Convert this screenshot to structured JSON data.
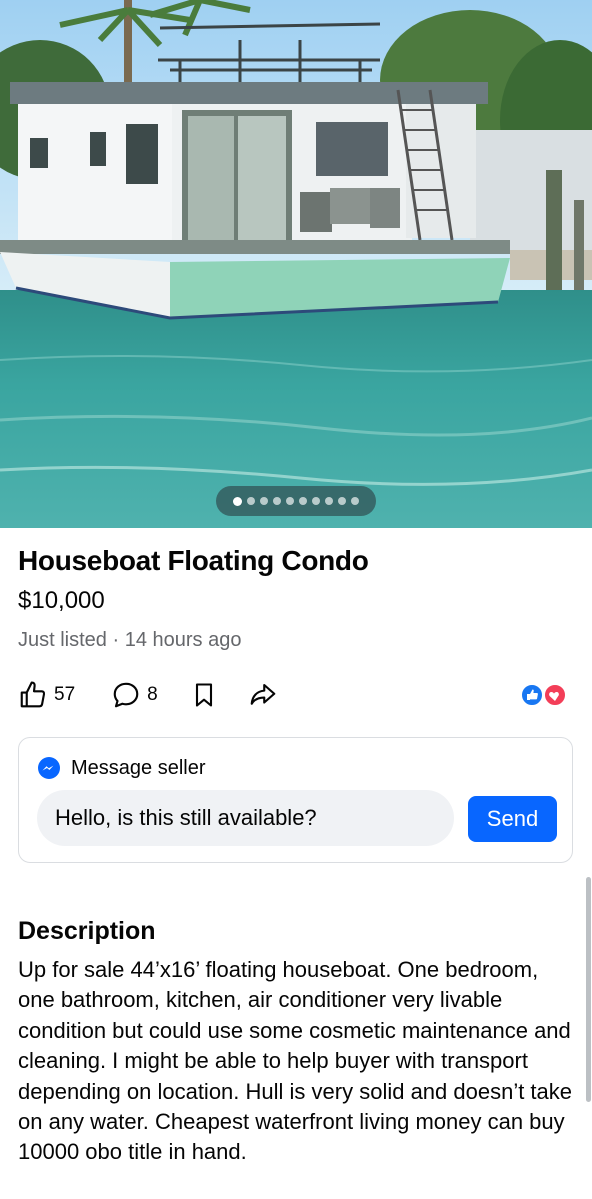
{
  "listing": {
    "title": "Houseboat Floating Condo",
    "price": "$10,000",
    "meta": "Just listed · 14 hours ago"
  },
  "photo_carousel": {
    "total_photos": 10,
    "current_index": 1,
    "subject": "white houseboat with teal hull on water"
  },
  "actions": {
    "like_count": "57",
    "comment_count": "8",
    "icons": [
      "thumbs-up-icon",
      "comment-icon",
      "bookmark-icon",
      "share-icon"
    ]
  },
  "reactions": {
    "icons": [
      "like-reaction-icon",
      "love-reaction-icon"
    ]
  },
  "message": {
    "header": "Message seller",
    "input_value": "Hello, is this still available?",
    "send_label": "Send"
  },
  "description": {
    "heading": "Description",
    "body": "Up for sale 44’x16’ floating houseboat. One bedroom, one bathroom, kitchen, air conditioner very livable condition but could use some cosmetic maintenance and cleaning. I might be able to help buyer with transport depending on location. Hull is very solid and doesn’t take on any water. Cheapest waterfront living money can buy 10000 obo title in hand."
  },
  "colors": {
    "accent": "#0866ff",
    "secondary_text": "#65676b",
    "hull": "#8fd3b8",
    "water": "#3aa39a",
    "sky": "#bfe2f7"
  }
}
